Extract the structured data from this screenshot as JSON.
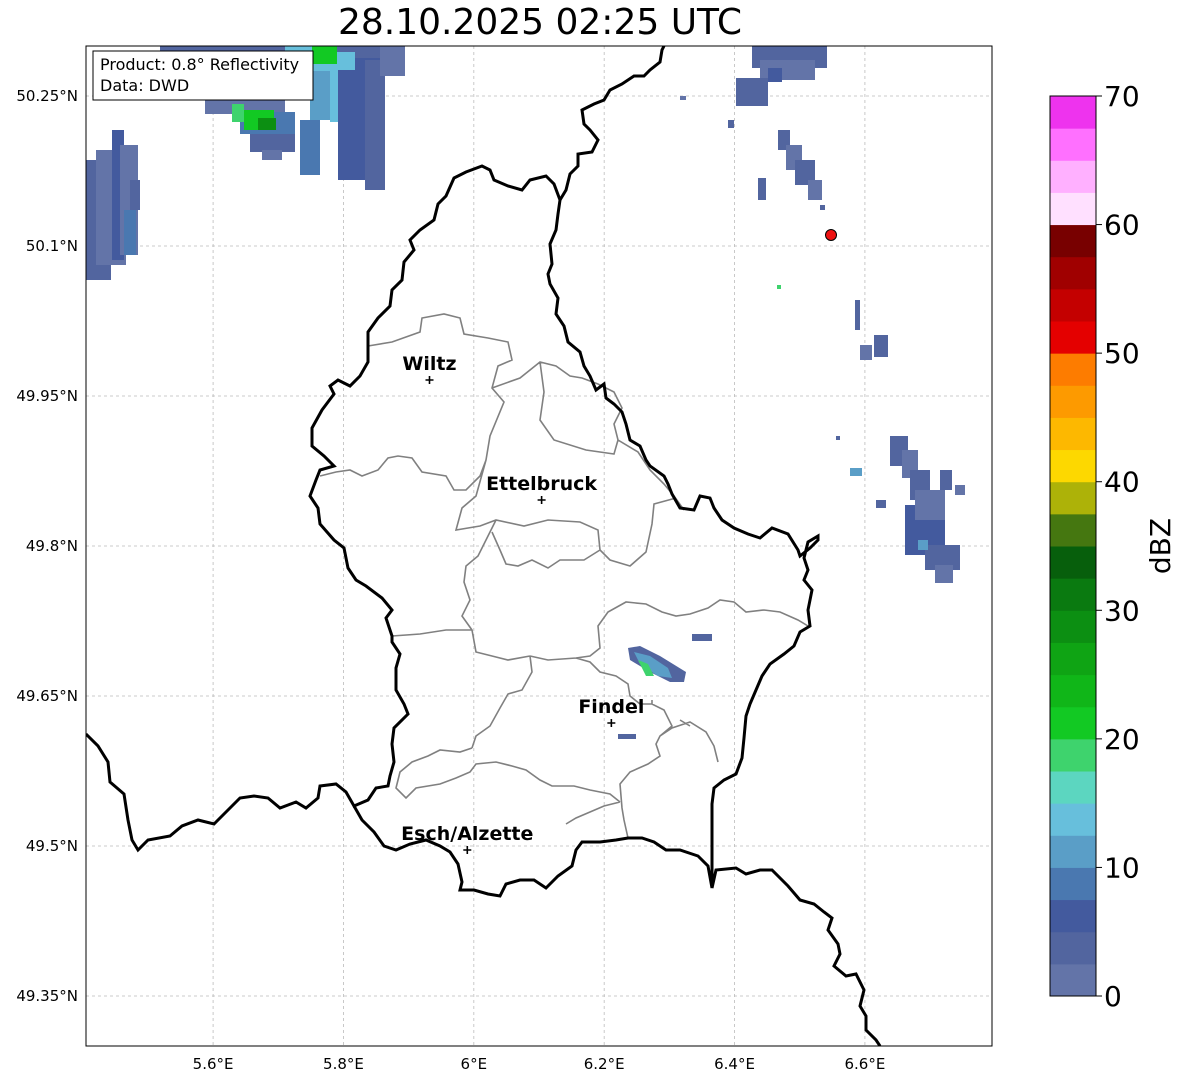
{
  "title": "28.10.2025 02:25 UTC",
  "info_box": {
    "product": "Product: 0.8° Reflectivity",
    "data_source": "Data: DWD"
  },
  "map": {
    "lon_range": [
      5.405,
      6.795
    ],
    "lat_range": [
      49.3,
      50.3
    ],
    "lon_ticks": [
      {
        "value": 5.6,
        "label": "5.6°E"
      },
      {
        "value": 5.8,
        "label": "5.8°E"
      },
      {
        "value": 6.0,
        "label": "6°E"
      },
      {
        "value": 6.2,
        "label": "6.2°E"
      },
      {
        "value": 6.4,
        "label": "6.4°E"
      },
      {
        "value": 6.6,
        "label": "6.6°E"
      }
    ],
    "lat_ticks": [
      {
        "value": 49.35,
        "label": "49.35°N"
      },
      {
        "value": 49.5,
        "label": "49.5°N"
      },
      {
        "value": 49.65,
        "label": "49.65°N"
      },
      {
        "value": 49.8,
        "label": "49.8°N"
      },
      {
        "value": 49.95,
        "label": "49.95°N"
      },
      {
        "value": 50.1,
        "label": "50.1°N"
      },
      {
        "value": 50.25,
        "label": "50.25°N"
      }
    ],
    "cities": [
      {
        "name": "Wiltz",
        "lon": 5.932,
        "lat": 49.966
      },
      {
        "name": "Ettelbruck",
        "lon": 6.104,
        "lat": 49.846
      },
      {
        "name": "Findel",
        "lon": 6.211,
        "lat": 49.623
      },
      {
        "name": "Esch/Alzette",
        "lon": 5.99,
        "lat": 49.496
      }
    ],
    "radar_site": {
      "lon": 6.548,
      "lat": 50.111,
      "color": "#ee1111"
    }
  },
  "colorbar": {
    "label": "dBZ",
    "min": 0,
    "max": 70,
    "tick_values": [
      0,
      10,
      20,
      30,
      40,
      50,
      60,
      70
    ],
    "tick_labels": [
      "0",
      "10",
      "20",
      "30",
      "40",
      "50",
      "60",
      "70"
    ],
    "colors": [
      "#6374a8",
      "#52659f",
      "#435a9e",
      "#4a78b0",
      "#5a9ec7",
      "#67bfdc",
      "#5cd6c0",
      "#3ed36d",
      "#12c923",
      "#10b618",
      "#0fa414",
      "#0c8f12",
      "#0a7a10",
      "#075f0c",
      "#457710",
      "#adb208",
      "#fdd800",
      "#fdb800",
      "#fd9a00",
      "#fd7c00",
      "#e40000",
      "#c40000",
      "#a00000",
      "#780000",
      "#ffe0ff",
      "#ffb0ff",
      "#ff70ff",
      "#ee33ee"
    ]
  }
}
